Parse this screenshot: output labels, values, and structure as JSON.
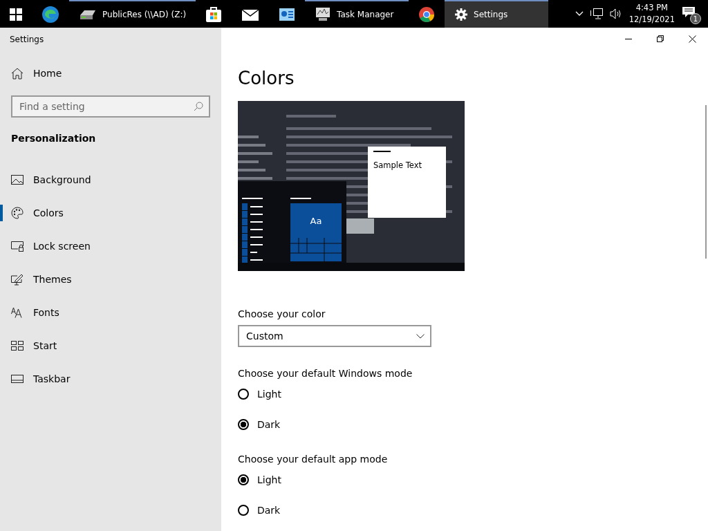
{
  "taskbar": {
    "apps": [
      {
        "kind": "start",
        "running": false,
        "selected": false
      },
      {
        "kind": "edge",
        "running": false,
        "selected": false
      },
      {
        "kind": "drive",
        "label": "PublicRes (\\\\AD) (Z:)",
        "running": true,
        "selected": false
      },
      {
        "kind": "store",
        "running": false,
        "selected": false
      },
      {
        "kind": "mail",
        "running": false,
        "selected": false
      },
      {
        "kind": "app",
        "running": false,
        "selected": false
      },
      {
        "kind": "taskmgr",
        "label": "Task Manager",
        "running": true,
        "selected": false
      },
      {
        "kind": "chrome",
        "running": false,
        "selected": false
      },
      {
        "kind": "settings",
        "label": "Settings",
        "running": true,
        "selected": true
      }
    ],
    "time": "4:43 PM",
    "date": "12/19/2021",
    "notifications": "1"
  },
  "window": {
    "title": "Settings"
  },
  "sidebar": {
    "home": "Home",
    "search": {
      "placeholder": "Find a setting"
    },
    "section": "Personalization",
    "items": [
      {
        "kind": "background",
        "label": "Background",
        "selected": false
      },
      {
        "kind": "colors",
        "label": "Colors",
        "selected": true
      },
      {
        "kind": "lock",
        "label": "Lock screen",
        "selected": false
      },
      {
        "kind": "themes",
        "label": "Themes",
        "selected": false
      },
      {
        "kind": "fonts",
        "label": "Fonts",
        "selected": false
      },
      {
        "kind": "start",
        "label": "Start",
        "selected": false
      },
      {
        "kind": "taskbar",
        "label": "Taskbar",
        "selected": false
      }
    ]
  },
  "content": {
    "title": "Colors",
    "preview": {
      "tile_text": "Aa",
      "sample_text": "Sample Text"
    },
    "color_choice": {
      "label": "Choose your color",
      "value": "Custom"
    },
    "groups": [
      {
        "label": "Choose your default Windows mode",
        "options": [
          {
            "label": "Light",
            "selected": false
          },
          {
            "label": "Dark",
            "selected": true
          }
        ]
      },
      {
        "label": "Choose your default app mode",
        "options": [
          {
            "label": "Light",
            "selected": true
          },
          {
            "label": "Dark",
            "selected": false
          }
        ]
      }
    ]
  }
}
